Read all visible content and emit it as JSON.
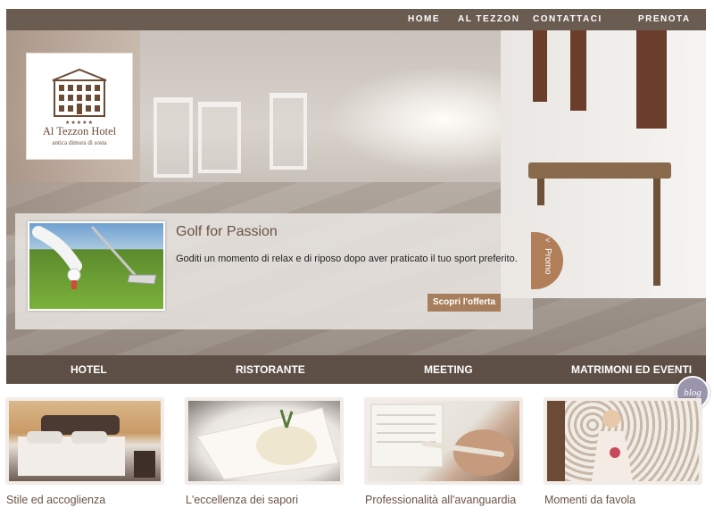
{
  "top_nav": {
    "items": [
      {
        "label": "HOME"
      },
      {
        "label": "AL TEZZON"
      },
      {
        "label": "CONTATTACI"
      },
      {
        "label": "PRENOTA"
      }
    ]
  },
  "logo": {
    "stars": "★★★★★",
    "name": "Al Tezzon Hotel",
    "subtitle": "antica dimora di sosta"
  },
  "promo": {
    "title": "Golf for Passion",
    "text": "Goditi un momento di relax e di riposo dopo aver praticato il tuo sport preferito.",
    "button_label": "Scopri l'offerta",
    "tab_label": "Promo",
    "tab_chevron": "<"
  },
  "main_nav": {
    "items": [
      {
        "label": "HOTEL"
      },
      {
        "label": "RISTORANTE"
      },
      {
        "label": "MEETING"
      },
      {
        "label": "MATRIMONI ED EVENTI"
      }
    ]
  },
  "blog_badge": "blog",
  "cards": [
    {
      "caption": "Stile ed accoglienza"
    },
    {
      "caption": "L'eccellenza dei sapori"
    },
    {
      "caption": "Professionalità all'avanguardia"
    },
    {
      "caption": "Momenti da favola"
    }
  ],
  "colors": {
    "nav_bg": "#6b5c52",
    "main_nav_bg": "#5d4f45",
    "accent": "#a87f5c",
    "caption": "#6b5344"
  }
}
